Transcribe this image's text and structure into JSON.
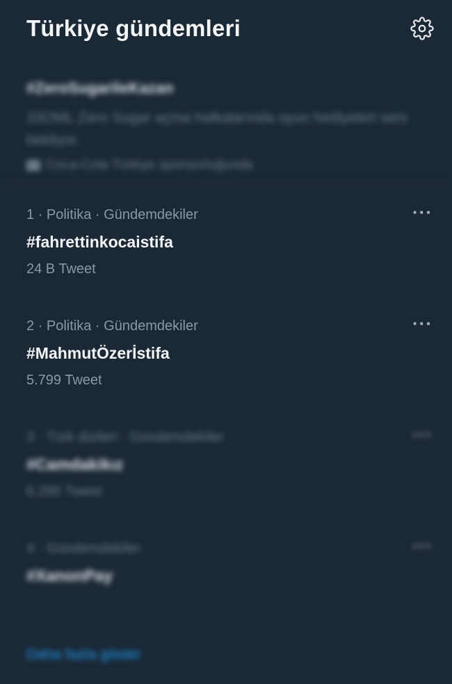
{
  "header": {
    "title": "Türkiye gündemleri",
    "settings_icon": "gear-icon"
  },
  "promo": {
    "tag": "#ZeroSugarileKazan",
    "description": "33OML Zero Sugar açma halkalarında oyun hediyeleri seni bekliyor.",
    "sponsor": "Coca-Cola Türkiye sponsorluğunda"
  },
  "trends": [
    {
      "meta": "1 · Politika · Gündemdekiler",
      "name": "#fahrettinkocaistifa",
      "count": "24 B Tweet",
      "more_label": "···"
    },
    {
      "meta": "2 · Politika · Gündemdekiler",
      "name": "#MahmutÖzerİstifa",
      "count": "5.799 Tweet",
      "more_label": "···"
    },
    {
      "meta": "3 · Türk dizileri · Gündemdekiler",
      "name": "#Camdakikız",
      "count": "6.295 Tweet",
      "more_label": "···"
    },
    {
      "meta": "4 · Gündemdekiler",
      "name": "#XanonPay",
      "count": "",
      "more_label": "···"
    }
  ],
  "show_more": "Daha fazla göster",
  "colors": {
    "background": "#1b2836",
    "accent": "#1d9bf0",
    "secondary_text": "#8b98a5"
  }
}
